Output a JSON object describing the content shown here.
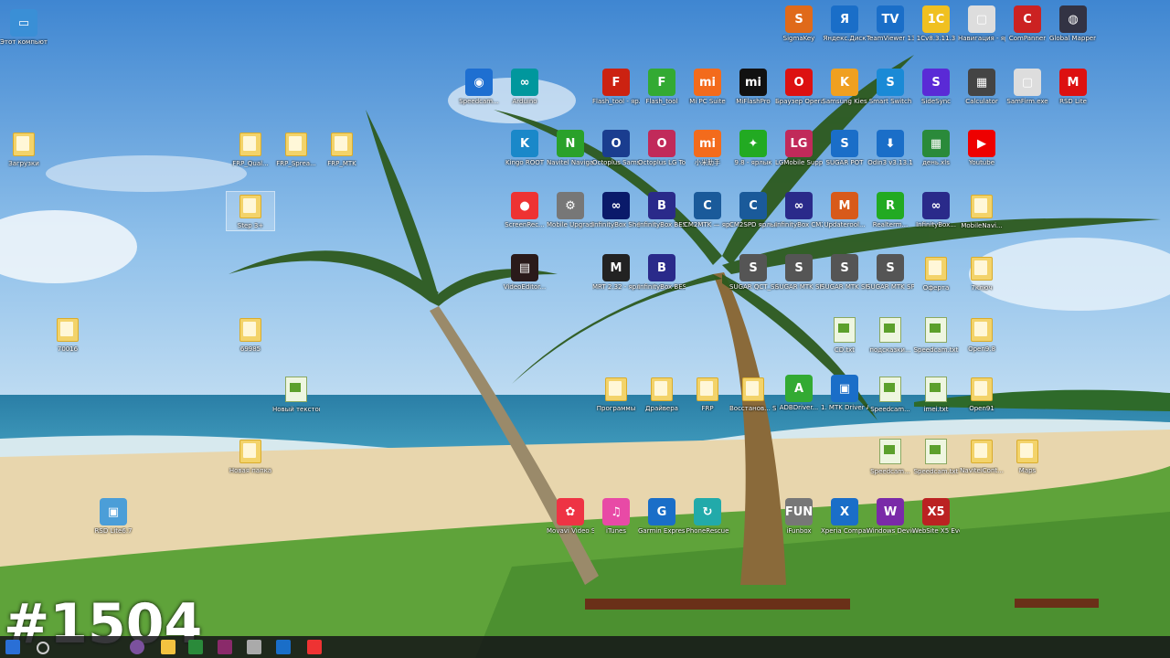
{
  "desktop": {
    "watermark": "#1504",
    "icons": [
      {
        "label": "Этот компьютер",
        "kind": "app",
        "color": "#3a8fd6",
        "glyph": "▭"
      },
      {
        "label": "Загрузки",
        "kind": "folder"
      },
      {
        "label": "70016",
        "kind": "folder"
      },
      {
        "label": "RSD Lite6.7",
        "kind": "app",
        "color": "#4b9ed8",
        "glyph": "▣"
      },
      {
        "label": "FRP_Qual...",
        "kind": "folder"
      },
      {
        "label": "FRP_Sprea...",
        "kind": "folder"
      },
      {
        "label": "FRP_MTK",
        "kind": "folder"
      },
      {
        "label": "Step 3+",
        "kind": "folder"
      },
      {
        "label": "69985",
        "kind": "folder"
      },
      {
        "label": "Новый текстов...",
        "kind": "doc"
      },
      {
        "label": "Новая папка",
        "kind": "folder"
      },
      {
        "label": "Speedcam...",
        "kind": "app",
        "color": "#1e6fd1",
        "glyph": "◉"
      },
      {
        "label": "Arduino",
        "kind": "app",
        "color": "#00979d",
        "glyph": "∞"
      },
      {
        "label": "Kingo ROOT",
        "kind": "app",
        "color": "#1a88c9",
        "glyph": "K"
      },
      {
        "label": "Navitel Navigat...",
        "kind": "app",
        "color": "#2aa12a",
        "glyph": "N"
      },
      {
        "label": "ScreenRec...",
        "kind": "app",
        "color": "#e33",
        "glyph": "●"
      },
      {
        "label": "Mobile Upgrade...",
        "kind": "app",
        "color": "#777",
        "glyph": "⚙"
      },
      {
        "label": "VideoEditor...",
        "kind": "app",
        "color": "#2a1a1a",
        "glyph": "▤"
      },
      {
        "label": "Movavi Video Sui...",
        "kind": "app",
        "color": "#e34",
        "glyph": "✿"
      },
      {
        "label": "Flash_tool - ярлык",
        "kind": "app",
        "color": "#c21",
        "glyph": "F"
      },
      {
        "label": "Octoplus Samsun...",
        "kind": "app",
        "color": "#1a3d8f",
        "glyph": "O"
      },
      {
        "label": "InfinityBox Shell",
        "kind": "app",
        "color": "#0a1a6a",
        "glyph": "∞"
      },
      {
        "label": "MRT 2.32 - ярлык",
        "kind": "app",
        "color": "#222",
        "glyph": "M"
      },
      {
        "label": "Программы",
        "kind": "folder"
      },
      {
        "label": "iTunes",
        "kind": "app",
        "color": "#e84aa6",
        "glyph": "♫"
      },
      {
        "label": "Flash_tool",
        "kind": "app",
        "color": "#3a3",
        "glyph": "F"
      },
      {
        "label": "Octoplus LG Tool",
        "kind": "app",
        "color": "#c12a5a",
        "glyph": "O"
      },
      {
        "label": "InfinityBox BEST",
        "kind": "app",
        "color": "#2a2a8a",
        "glyph": "B"
      },
      {
        "label": "InfinityBox BEST2",
        "kind": "app",
        "color": "#2a2a8a",
        "glyph": "B"
      },
      {
        "label": "Драйвера",
        "kind": "folder"
      },
      {
        "label": "Garmin Express",
        "kind": "app",
        "color": "#1a6ec8",
        "glyph": "G"
      },
      {
        "label": "Mi PC Suite",
        "kind": "app",
        "color": "#f36b1c",
        "glyph": "mi"
      },
      {
        "label": "小米助手",
        "kind": "app",
        "color": "#f36b1c",
        "glyph": "mi"
      },
      {
        "label": "CM2MTK — ярлык",
        "kind": "app",
        "color": "#1a5a9a",
        "glyph": "C"
      },
      {
        "label": "FRP",
        "kind": "folder"
      },
      {
        "label": "PhoneRescue",
        "kind": "app",
        "color": "#2aa",
        "glyph": "↻"
      },
      {
        "label": "MiFlashPro",
        "kind": "app",
        "color": "#111",
        "glyph": "mi"
      },
      {
        "label": "9.8 - ярлык",
        "kind": "app",
        "color": "#2a2",
        "glyph": "✦"
      },
      {
        "label": "CM2SPD ярлык",
        "kind": "app",
        "color": "#1a5a9a",
        "glyph": "C"
      },
      {
        "label": "SUGAR QCT_SP",
        "kind": "app",
        "color": "#555",
        "glyph": "S"
      },
      {
        "label": "Восстанов... SN",
        "kind": "folder"
      },
      {
        "label": "Браузер Opera",
        "kind": "app",
        "color": "#d11",
        "glyph": "O"
      },
      {
        "label": "LGMobile Support Tool",
        "kind": "app",
        "color": "#c12a5a",
        "glyph": "LG"
      },
      {
        "label": "InfinityBox CM2QLM",
        "kind": "app",
        "color": "#2a2a8a",
        "glyph": "∞"
      },
      {
        "label": "SUGAR MTK SP G...",
        "kind": "app",
        "color": "#555",
        "glyph": "S"
      },
      {
        "label": "ADBDriver...",
        "kind": "app",
        "color": "#3a3",
        "glyph": "A"
      },
      {
        "label": "iFunbox",
        "kind": "app",
        "color": "#777",
        "glyph": "FUN"
      },
      {
        "label": "SigmaKey",
        "kind": "app",
        "color": "#e06a1a",
        "glyph": "S"
      },
      {
        "label": "Samsung Kies",
        "kind": "app",
        "color": "#f0a020",
        "glyph": "K"
      },
      {
        "label": "SUGAR POT",
        "kind": "app",
        "color": "#1a6ec8",
        "glyph": "S"
      },
      {
        "label": "Updaterool...",
        "kind": "app",
        "color": "#d85a1a",
        "glyph": "M"
      },
      {
        "label": "SUGAR MTK SP_G...",
        "kind": "app",
        "color": "#555",
        "glyph": "S"
      },
      {
        "label": "CD.txt",
        "kind": "doc"
      },
      {
        "label": "1. MTK Driver Auto Install...",
        "kind": "app",
        "color": "#1a6ec8",
        "glyph": "▣"
      },
      {
        "label": "Xperia Companion",
        "kind": "app",
        "color": "#1a6ec8",
        "glyph": "X"
      },
      {
        "label": "Яндекс.Диск",
        "kind": "app",
        "color": "#1a6ec8",
        "glyph": "Я"
      },
      {
        "label": "Smart Switch",
        "kind": "app",
        "color": "#1a8ad6",
        "glyph": "S"
      },
      {
        "label": "Odin3 v3.13.1",
        "kind": "app",
        "color": "#1a6ec8",
        "glyph": "⬇"
      },
      {
        "label": "Realterm...",
        "kind": "app",
        "color": "#2a2",
        "glyph": "R"
      },
      {
        "label": "SUGAR MTK SP",
        "kind": "app",
        "color": "#555",
        "glyph": "S"
      },
      {
        "label": "подсказки...",
        "kind": "doc"
      },
      {
        "label": "Speedcam...",
        "kind": "doc"
      },
      {
        "label": "Speedcam...",
        "kind": "doc"
      },
      {
        "label": "Windows Device...",
        "kind": "app",
        "color": "#7a2aa8",
        "glyph": "W"
      },
      {
        "label": "TeamViewer 13",
        "kind": "app",
        "color": "#1a6ec8",
        "glyph": "TV"
      },
      {
        "label": "SideSync",
        "kind": "app",
        "color": "#5a2ad6",
        "glyph": "S"
      },
      {
        "label": "день.xls",
        "kind": "app",
        "color": "#2a8a3a",
        "glyph": "▦"
      },
      {
        "label": "InfinityBox...",
        "kind": "app",
        "color": "#2a2a8a",
        "glyph": "∞"
      },
      {
        "label": "Оферта",
        "kind": "folder"
      },
      {
        "label": "Speedcam.txt",
        "kind": "doc"
      },
      {
        "label": "imei.txt",
        "kind": "doc"
      },
      {
        "label": "Speedcam.txt",
        "kind": "doc"
      },
      {
        "label": "WebSite X5 Evolution 15",
        "kind": "app",
        "color": "#b22",
        "glyph": "X5"
      },
      {
        "label": "1Cv8.3.11.3",
        "kind": "app",
        "color": "#f0c020",
        "glyph": "1С"
      },
      {
        "label": "Calculator",
        "kind": "app",
        "color": "#444",
        "glyph": "▦"
      },
      {
        "label": "Youtube",
        "kind": "app",
        "color": "#e00",
        "glyph": "▶"
      },
      {
        "label": "MobileNavi...",
        "kind": "folder"
      },
      {
        "label": "7ключ",
        "kind": "folder"
      },
      {
        "label": "Open9.8",
        "kind": "folder"
      },
      {
        "label": "Open91",
        "kind": "folder"
      },
      {
        "label": "NaviteiCont...",
        "kind": "folder"
      },
      {
        "label": "Навигация - ярлык",
        "kind": "app",
        "color": "#ddd",
        "glyph": "▢"
      },
      {
        "label": "SamFirm.exe",
        "kind": "app",
        "color": "#ddd",
        "glyph": "▢"
      },
      {
        "label": "ComPanner",
        "kind": "app",
        "color": "#c22",
        "glyph": "C"
      },
      {
        "label": "Maps",
        "kind": "folder"
      },
      {
        "label": "RSD Lite",
        "kind": "app",
        "color": "#d11",
        "glyph": "M"
      },
      {
        "label": "Global Mapper 12",
        "kind": "app",
        "color": "#334",
        "glyph": "◍"
      }
    ]
  },
  "taskbar": {
    "buttons": [
      "start-icon",
      "search-icon",
      "task-view-icon",
      "viber-icon",
      "file-explorer-icon",
      "excel-icon",
      "winrar-icon",
      "device-icon",
      "teamviewer-icon",
      "screenrec-icon"
    ]
  }
}
